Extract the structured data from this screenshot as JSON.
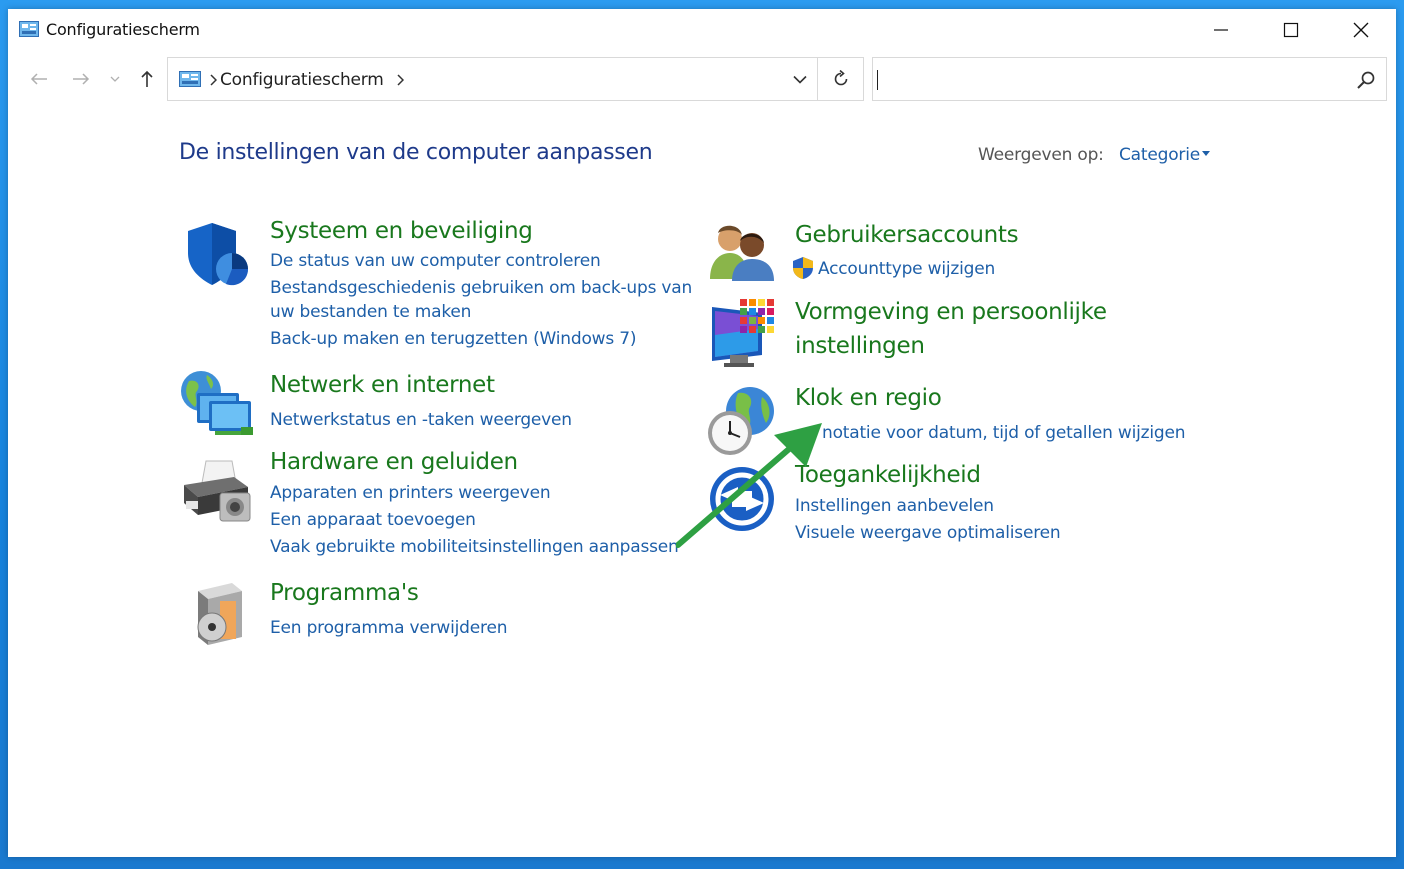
{
  "window": {
    "title": "Configuratiescherm"
  },
  "address_bar": {
    "crumb": "Configuratiescherm"
  },
  "search": {
    "placeholder": ""
  },
  "main": {
    "heading": "De instellingen van de computer aanpassen",
    "view_by_label": "Weergeven op:",
    "view_by_value": "Categorie"
  },
  "categories": {
    "system": {
      "title": "Systeem en beveiliging",
      "links": [
        "De status van uw computer controleren",
        "Bestandsgeschiedenis gebruiken om back-ups van",
        "uw bestanden te maken",
        "Back-up maken en terugzetten (Windows 7)"
      ]
    },
    "network": {
      "title": "Netwerk en internet",
      "links": [
        "Netwerkstatus en -taken weergeven"
      ]
    },
    "hardware": {
      "title": "Hardware en geluiden",
      "links": [
        "Apparaten en printers weergeven",
        "Een apparaat toevoegen",
        "Vaak gebruikte mobiliteitsinstellingen aanpassen"
      ]
    },
    "programs": {
      "title": "Programma's",
      "links": [
        "Een programma verwijderen"
      ]
    },
    "users": {
      "title": "Gebruikersaccounts",
      "links": [
        "Accounttype wijzigen"
      ]
    },
    "appearance": {
      "title_line1": "Vormgeving en persoonlijke",
      "title_line2": "instellingen"
    },
    "clock": {
      "title": "Klok en regio",
      "links": [
        "notatie voor datum, tijd of getallen wijzigen"
      ]
    },
    "ease": {
      "title": "Toegankelijkheid",
      "links": [
        "Instellingen aanbevelen",
        "Visuele weergave optimaliseren"
      ]
    }
  },
  "colors": {
    "category_title": "#19781d",
    "link": "#1e5fa8",
    "heading": "#1e3a8a",
    "annotation_arrow": "#2ea043"
  }
}
